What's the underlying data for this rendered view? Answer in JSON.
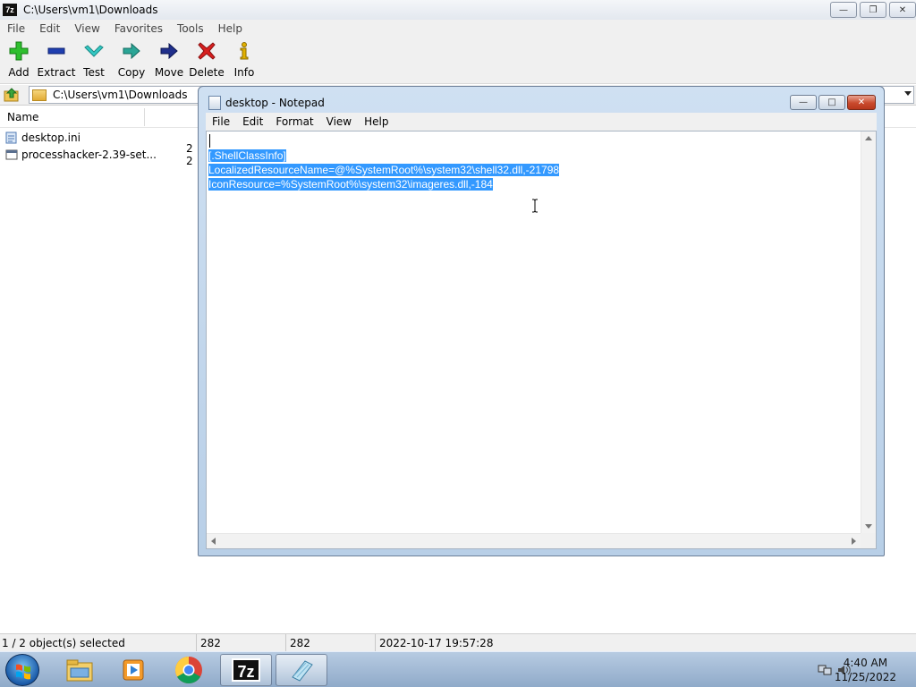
{
  "sevenzip": {
    "app_icon_text": "7z",
    "title": "C:\\Users\\vm1\\Downloads",
    "menu": [
      "File",
      "Edit",
      "View",
      "Favorites",
      "Tools",
      "Help"
    ],
    "toolbar": {
      "add": "Add",
      "extract": "Extract",
      "test": "Test",
      "copy": "Copy",
      "move": "Move",
      "delete": "Delete",
      "info": "Info"
    },
    "address": "C:\\Users\\vm1\\Downloads",
    "columns": {
      "name": "Name"
    },
    "files": [
      {
        "name": "desktop.ini",
        "size": ""
      },
      {
        "name": "processhacker-2.39-set...",
        "size": "2 2"
      }
    ],
    "status": {
      "selected": "1 / 2 object(s) selected",
      "size": "282",
      "packed": "282",
      "modified": "2022-10-17 19:57:28"
    }
  },
  "notepad": {
    "title": "desktop - Notepad",
    "menu": [
      "File",
      "Edit",
      "Format",
      "View",
      "Help"
    ],
    "lines": [
      "",
      "[.ShellClassInfo]",
      "LocalizedResourceName=@%SystemRoot%\\system32\\shell32.dll,-21798",
      "IconResource=%SystemRoot%\\system32\\imageres.dll,-184"
    ]
  },
  "taskbar": {
    "sevenzip_label": "7z",
    "time": "4:40 AM",
    "date": "11/25/2022"
  },
  "colors": {
    "selection": "#3399ff",
    "close_red": "#c94a2d",
    "taskbar": "#8faac9"
  }
}
